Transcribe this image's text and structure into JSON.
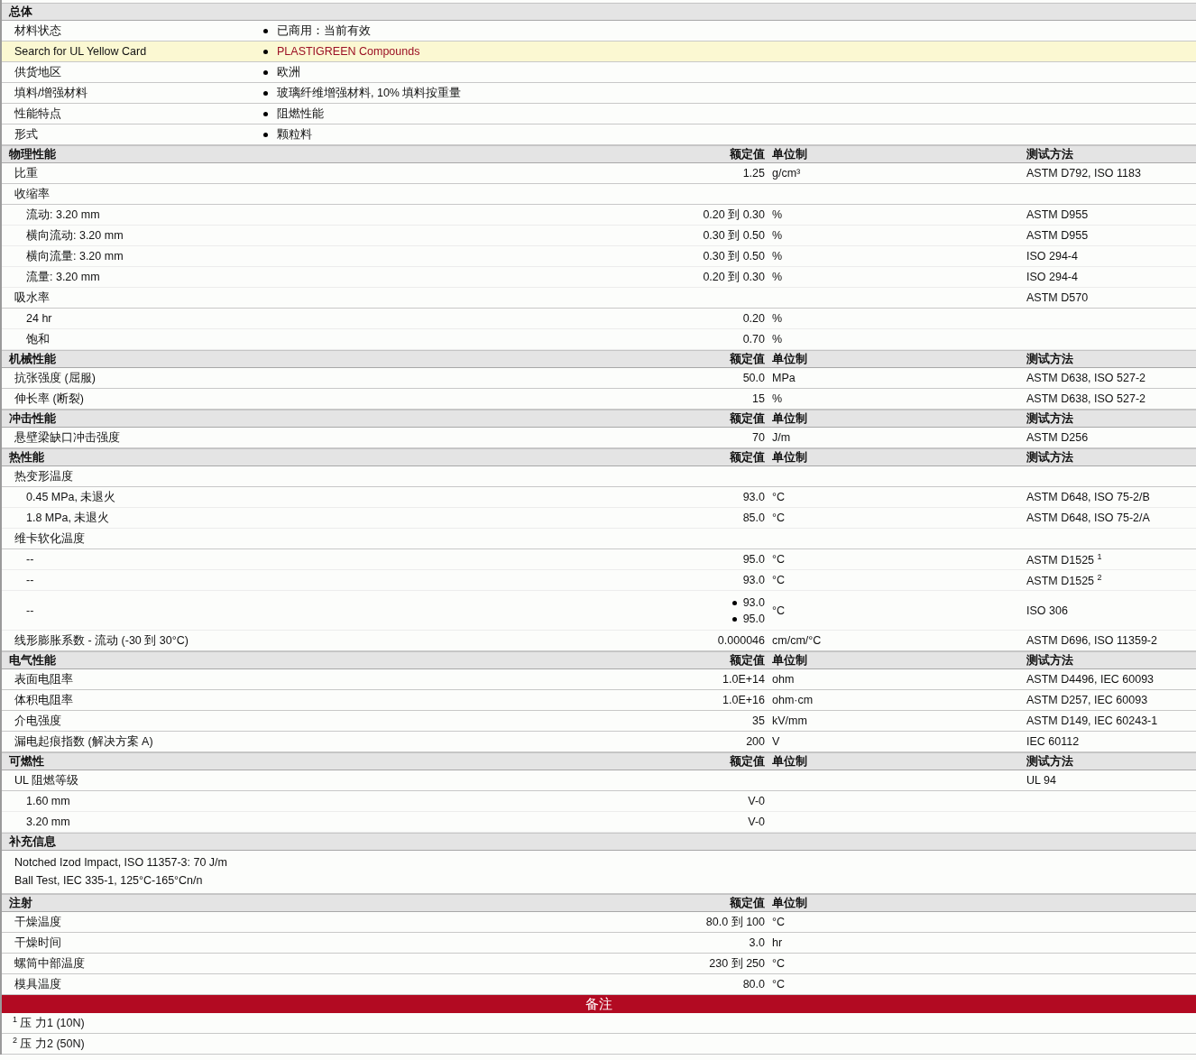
{
  "sections": [
    {
      "kind": "list",
      "title": "总体",
      "rows": [
        {
          "label": "材料状态",
          "value": "已商用：当前有效",
          "highlighted": false
        },
        {
          "label": "Search for UL Yellow Card",
          "value": "PLASTIGREEN Compounds",
          "highlighted": true
        },
        {
          "label": "供货地区",
          "value": "欧洲",
          "highlighted": false
        },
        {
          "label": "填料/增强材料",
          "value": "玻璃纤维增强材料, 10% 填料按重量",
          "highlighted": false
        },
        {
          "label": "性能特点",
          "value": "阻燃性能",
          "highlighted": false
        },
        {
          "label": "形式",
          "value": "颗粒料",
          "highlighted": false
        }
      ]
    },
    {
      "kind": "properties",
      "title": "物理性能",
      "value_header": "额定值",
      "unit_header": "单位制",
      "method_header": "测试方法",
      "rows": [
        {
          "label": "比重",
          "value": "1.25",
          "unit": "g/cm³",
          "method": "ASTM D792, ISO 1183"
        },
        {
          "label": "收缩率",
          "children": [
            {
              "label": "流动: 3.20 mm",
              "value": "0.20 到  0.30",
              "unit": "%",
              "method": "ASTM D955"
            },
            {
              "label": "横向流动: 3.20 mm",
              "value": "0.30 到  0.50",
              "unit": "%",
              "method": "ASTM D955"
            },
            {
              "label": "横向流量: 3.20 mm",
              "value": "0.30 到  0.50",
              "unit": "%",
              "method": "ISO 294-4"
            },
            {
              "label": "流量: 3.20 mm",
              "value": "0.20 到  0.30",
              "unit": "%",
              "method": "ISO 294-4"
            }
          ]
        },
        {
          "label": "吸水率",
          "method": "ASTM D570",
          "children": [
            {
              "label": "24 hr",
              "value": "0.20",
              "unit": "%"
            },
            {
              "label": "饱和",
              "value": "0.70",
              "unit": "%"
            }
          ]
        }
      ]
    },
    {
      "kind": "properties",
      "title": "机械性能",
      "value_header": "额定值",
      "unit_header": "单位制",
      "method_header": "测试方法",
      "rows": [
        {
          "label": "抗张强度  (屈服)",
          "value": "50.0",
          "unit": "MPa",
          "method": "ASTM D638, ISO 527-2"
        },
        {
          "label": "伸长率  (断裂)",
          "value": "15",
          "unit": "%",
          "method": "ASTM D638, ISO 527-2"
        }
      ]
    },
    {
      "kind": "properties",
      "title": "冲击性能",
      "value_header": "额定值",
      "unit_header": "单位制",
      "method_header": "测试方法",
      "rows": [
        {
          "label": "悬壁梁缺口冲击强度",
          "value": "70",
          "unit": "J/m",
          "method": "ASTM D256"
        }
      ]
    },
    {
      "kind": "properties",
      "title": "热性能",
      "value_header": "额定值",
      "unit_header": "单位制",
      "method_header": "测试方法",
      "rows": [
        {
          "label": "热变形温度",
          "children": [
            {
              "label": "0.45 MPa, 未退火",
              "value": "93.0",
              "unit": "°C",
              "method": "ASTM D648, ISO 75-2/B"
            },
            {
              "label": "1.8 MPa, 未退火",
              "value": "85.0",
              "unit": "°C",
              "method": "ASTM D648, ISO 75-2/A"
            }
          ]
        },
        {
          "label": "维卡软化温度",
          "children": [
            {
              "label": "--",
              "value": "95.0",
              "unit": "°C",
              "method": "ASTM D1525 $^{1}$"
            },
            {
              "label": "--",
              "value": "93.0",
              "unit": "°C",
              "method": "ASTM D1525 $^{2}$"
            },
            {
              "label": "--",
              "values": [
                "93.0",
                "95.0"
              ],
              "unit": "°C",
              "method": "ISO 306"
            }
          ]
        },
        {
          "label": "线形膨胀系数  - 流动  (-30 到  30°C)",
          "value": "0.000046",
          "unit": "cm/cm/°C",
          "method": "ASTM D696, ISO 11359-2"
        }
      ]
    },
    {
      "kind": "properties",
      "title": "电气性能",
      "value_header": "额定值",
      "unit_header": "单位制",
      "method_header": "测试方法",
      "rows": [
        {
          "label": "表面电阻率",
          "value": "1.0E+14",
          "unit": "ohm",
          "method": "ASTM D4496, IEC 60093"
        },
        {
          "label": "体积电阻率",
          "value": "1.0E+16",
          "unit": "ohm·cm",
          "method": "ASTM D257, IEC 60093"
        },
        {
          "label": "介电强度",
          "value": "35",
          "unit": "kV/mm",
          "method": "ASTM D149, IEC 60243-1"
        },
        {
          "label": "漏电起痕指数  (解决方案  A)",
          "value": "200",
          "unit": "V",
          "method": "IEC 60112"
        }
      ]
    },
    {
      "kind": "properties",
      "title": "可燃性",
      "value_header": "额定值",
      "unit_header": "单位制",
      "method_header": "测试方法",
      "rows": [
        {
          "label": "UL 阻燃等级",
          "method": "UL 94",
          "children": [
            {
              "label": "1.60 mm",
              "value": "V-0"
            },
            {
              "label": "3.20 mm",
              "value": "V-0"
            }
          ]
        }
      ]
    },
    {
      "kind": "text",
      "title": "补充信息",
      "lines": [
        "Notched Izod Impact, ISO 11357-3: 70 J/m",
        "Ball Test, IEC 335-1, 125°C-165°Cn/n"
      ]
    },
    {
      "kind": "properties",
      "title": "注射",
      "value_header": "额定值",
      "unit_header": "单位制",
      "rows": [
        {
          "label": "干燥温度",
          "value": "80.0 到  100",
          "unit": "°C"
        },
        {
          "label": "干燥时间",
          "value": "3.0",
          "unit": "hr"
        },
        {
          "label": "螺筒中部温度",
          "value": "230 到  250",
          "unit": "°C"
        },
        {
          "label": "模具温度",
          "value": "80.0",
          "unit": "°C"
        }
      ]
    },
    {
      "kind": "notes",
      "title": "备注",
      "notes": [
        "$^{1}$ 压  力1 (10N)",
        "$^{2}$ 压  力2 (50N)"
      ]
    }
  ]
}
